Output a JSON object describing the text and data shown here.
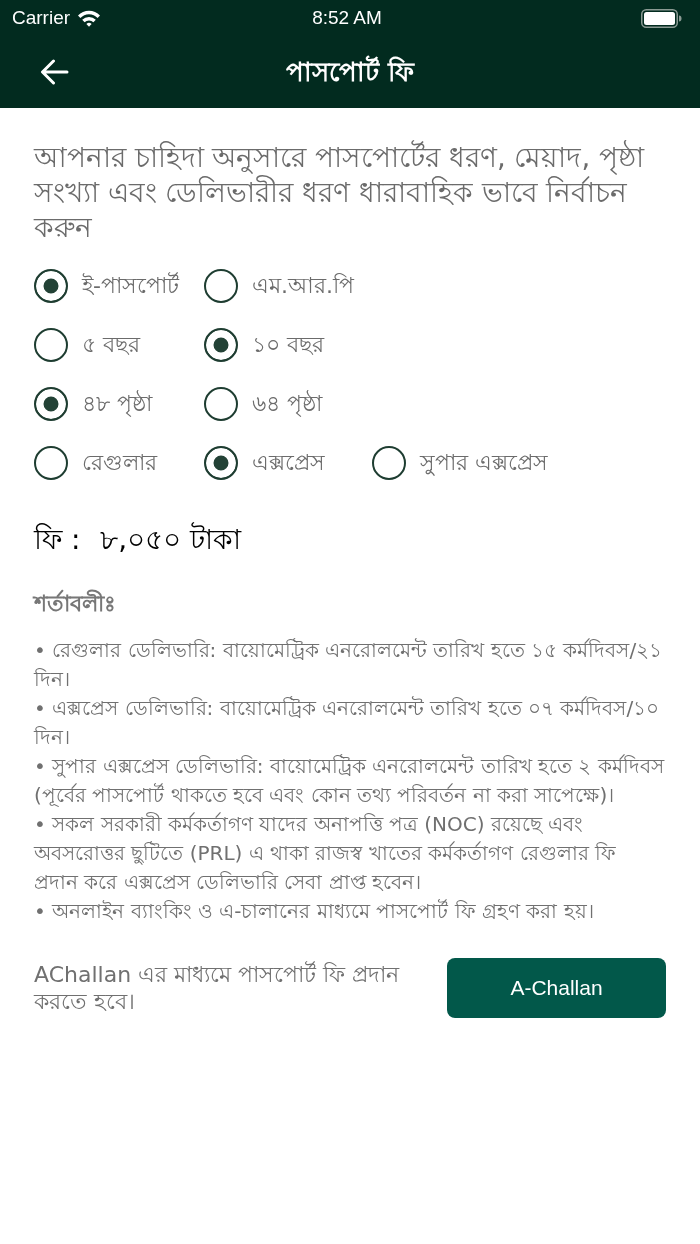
{
  "status_bar": {
    "carrier": "Carrier",
    "time": "8:52 AM"
  },
  "header": {
    "title": "পাসপোর্ট ফি"
  },
  "intro": "আপনার চাহিদা অনুসারে পাসপোর্টের ধরণ, মেয়াদ, পৃষ্ঠা সংখ্যা এবং ডেলিভারীর ধরণ ধারাবাহিক ভাবে নির্বাচন করুন",
  "option_groups": [
    {
      "options": [
        {
          "label": "ই-পাসপোর্ট",
          "selected": true
        },
        {
          "label": "এম.আর.পি",
          "selected": false
        }
      ]
    },
    {
      "options": [
        {
          "label": "৫ বছর",
          "selected": false
        },
        {
          "label": "১০ বছর",
          "selected": true
        }
      ]
    },
    {
      "options": [
        {
          "label": "৪৮ পৃষ্ঠা",
          "selected": true
        },
        {
          "label": "৬৪ পৃষ্ঠা",
          "selected": false
        }
      ]
    },
    {
      "options": [
        {
          "label": "রেগুলার",
          "selected": false
        },
        {
          "label": "এক্সপ্রেস",
          "selected": true
        },
        {
          "label": "সুপার এক্সপ্রেস",
          "selected": false
        }
      ]
    }
  ],
  "fee": {
    "label": "ফি :",
    "amount": "৮,০৫০ টাকা"
  },
  "terms": {
    "title": "শর্তাবলীঃ",
    "items": [
      "• রেগুলার ডেলিভারি: বায়োমেট্রিক এনরোলমেন্ট তারিখ হতে ১৫ কর্মদিবস/২১ দিন।",
      "• এক্সপ্রেস ডেলিভারি: বায়োমেট্রিক এনরোলমেন্ট তারিখ হতে ০৭ কর্মদিবস/১০ দিন।",
      "• সুপার এক্সপ্রেস ডেলিভারি: বায়োমেট্রিক এনরোলমেন্ট তারিখ হতে ২ কর্মদিবস (পূর্বের পাসপোর্ট থাকতে হবে এবং কোন তথ্য পরিবর্তন না করা সাপেক্ষে)।",
      "• সকল সরকারী কর্মকর্তাগণ যাদের অনাপত্তি পত্র (NOC) রয়েছে এবং অবসরোত্তর ছুটিতে (PRL) এ থাকা রাজস্ব খাতের কর্মকর্তাগণ রেগুলার ফি প্রদান করে এক্সপ্রেস ডেলিভারি সেবা প্রাপ্ত হবেন।",
      "• অনলাইন ব্যাংকিং ও এ-চালানের মাধ্যমে পাসপোর্ট ফি গ্রহণ করা হয়।"
    ]
  },
  "payment": {
    "note": "AChallan এর মাধ্যমে পাসপোর্ট ফি প্রদান করতে হবে।",
    "button": "A-Challan"
  }
}
